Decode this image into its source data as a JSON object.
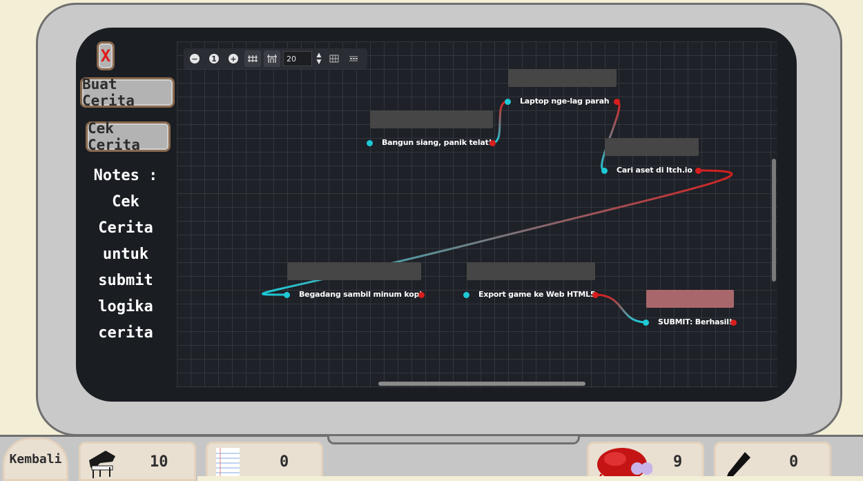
{
  "sidebar": {
    "close_label": "X",
    "create_story_label": "Buat Cerita",
    "check_story_label": "Cek Cerita",
    "notes_lines": [
      "Notes :",
      "Cek",
      "Cerita",
      "untuk",
      "submit",
      "logika",
      "cerita"
    ]
  },
  "toolbar": {
    "zoom_out": "−",
    "zoom_reset": "1",
    "zoom_in": "+",
    "snap_value": "20",
    "icons": [
      "zoom-out-icon",
      "zoom-reset-icon",
      "zoom-in-icon",
      "snap-grid-icon",
      "snap-toggle-icon",
      "minimap-icon",
      "arrange-icon"
    ]
  },
  "graph": {
    "nodes": [
      {
        "id": "bangun",
        "label": "Bangun siang, panik telat!"
      },
      {
        "id": "laptop",
        "label": "Laptop nge-lag parah"
      },
      {
        "id": "aset",
        "label": "Cari aset di Itch.io"
      },
      {
        "id": "begadang",
        "label": "Begadang sambil minum kopi"
      },
      {
        "id": "export",
        "label": "Export game ke Web HTML5"
      },
      {
        "id": "submit",
        "label": "SUBMIT: Berhasil!"
      }
    ],
    "colors": {
      "input_port": "#1ec9d6",
      "output_port": "#d81e1e",
      "node_header": "#464646",
      "submit_header": "#a8686b"
    }
  },
  "bottom_bar": {
    "back_label": "Kembali",
    "piano_count": "10",
    "notebook_count": "0",
    "bug_count": "9",
    "pencil_count": "0"
  }
}
